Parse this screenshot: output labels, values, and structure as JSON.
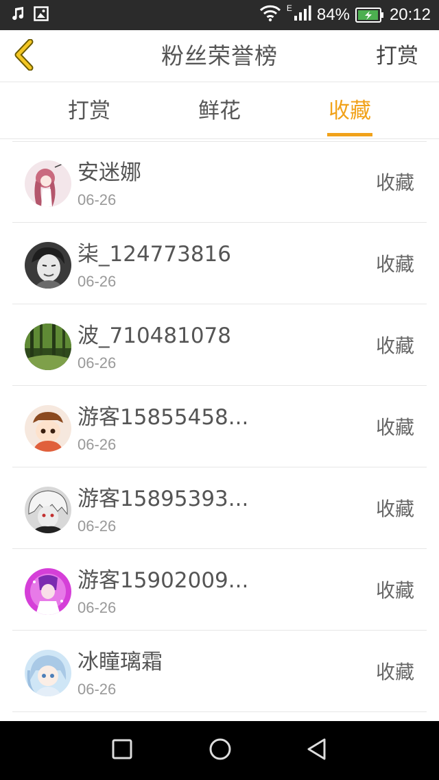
{
  "status_bar": {
    "network_type": "E",
    "battery_percent": "84%",
    "time": "20:12"
  },
  "header": {
    "title": "粉丝荣誉榜",
    "action_label": "打赏",
    "back_icon": "chevron-left-icon"
  },
  "tabs": [
    {
      "label": "打赏",
      "active": false
    },
    {
      "label": "鲜花",
      "active": false
    },
    {
      "label": "收藏",
      "active": true
    }
  ],
  "list": [
    {
      "name": "安迷娜",
      "date": "06-26",
      "action": "收藏"
    },
    {
      "name": "柒_124773816",
      "date": "06-26",
      "action": "收藏"
    },
    {
      "name": "波_710481078",
      "date": "06-26",
      "action": "收藏"
    },
    {
      "name": "游客15855458...",
      "date": "06-26",
      "action": "收藏"
    },
    {
      "name": "游客15895393...",
      "date": "06-26",
      "action": "收藏"
    },
    {
      "name": "游客15902009...",
      "date": "06-26",
      "action": "收藏"
    },
    {
      "name": "冰瞳璃霜",
      "date": "06-26",
      "action": "收藏"
    }
  ],
  "colors": {
    "accent": "#f1a21a",
    "back_chevron": "#e0b000",
    "status_bar_bg": "#2b2b2b",
    "battery_fill": "#4caf50"
  }
}
